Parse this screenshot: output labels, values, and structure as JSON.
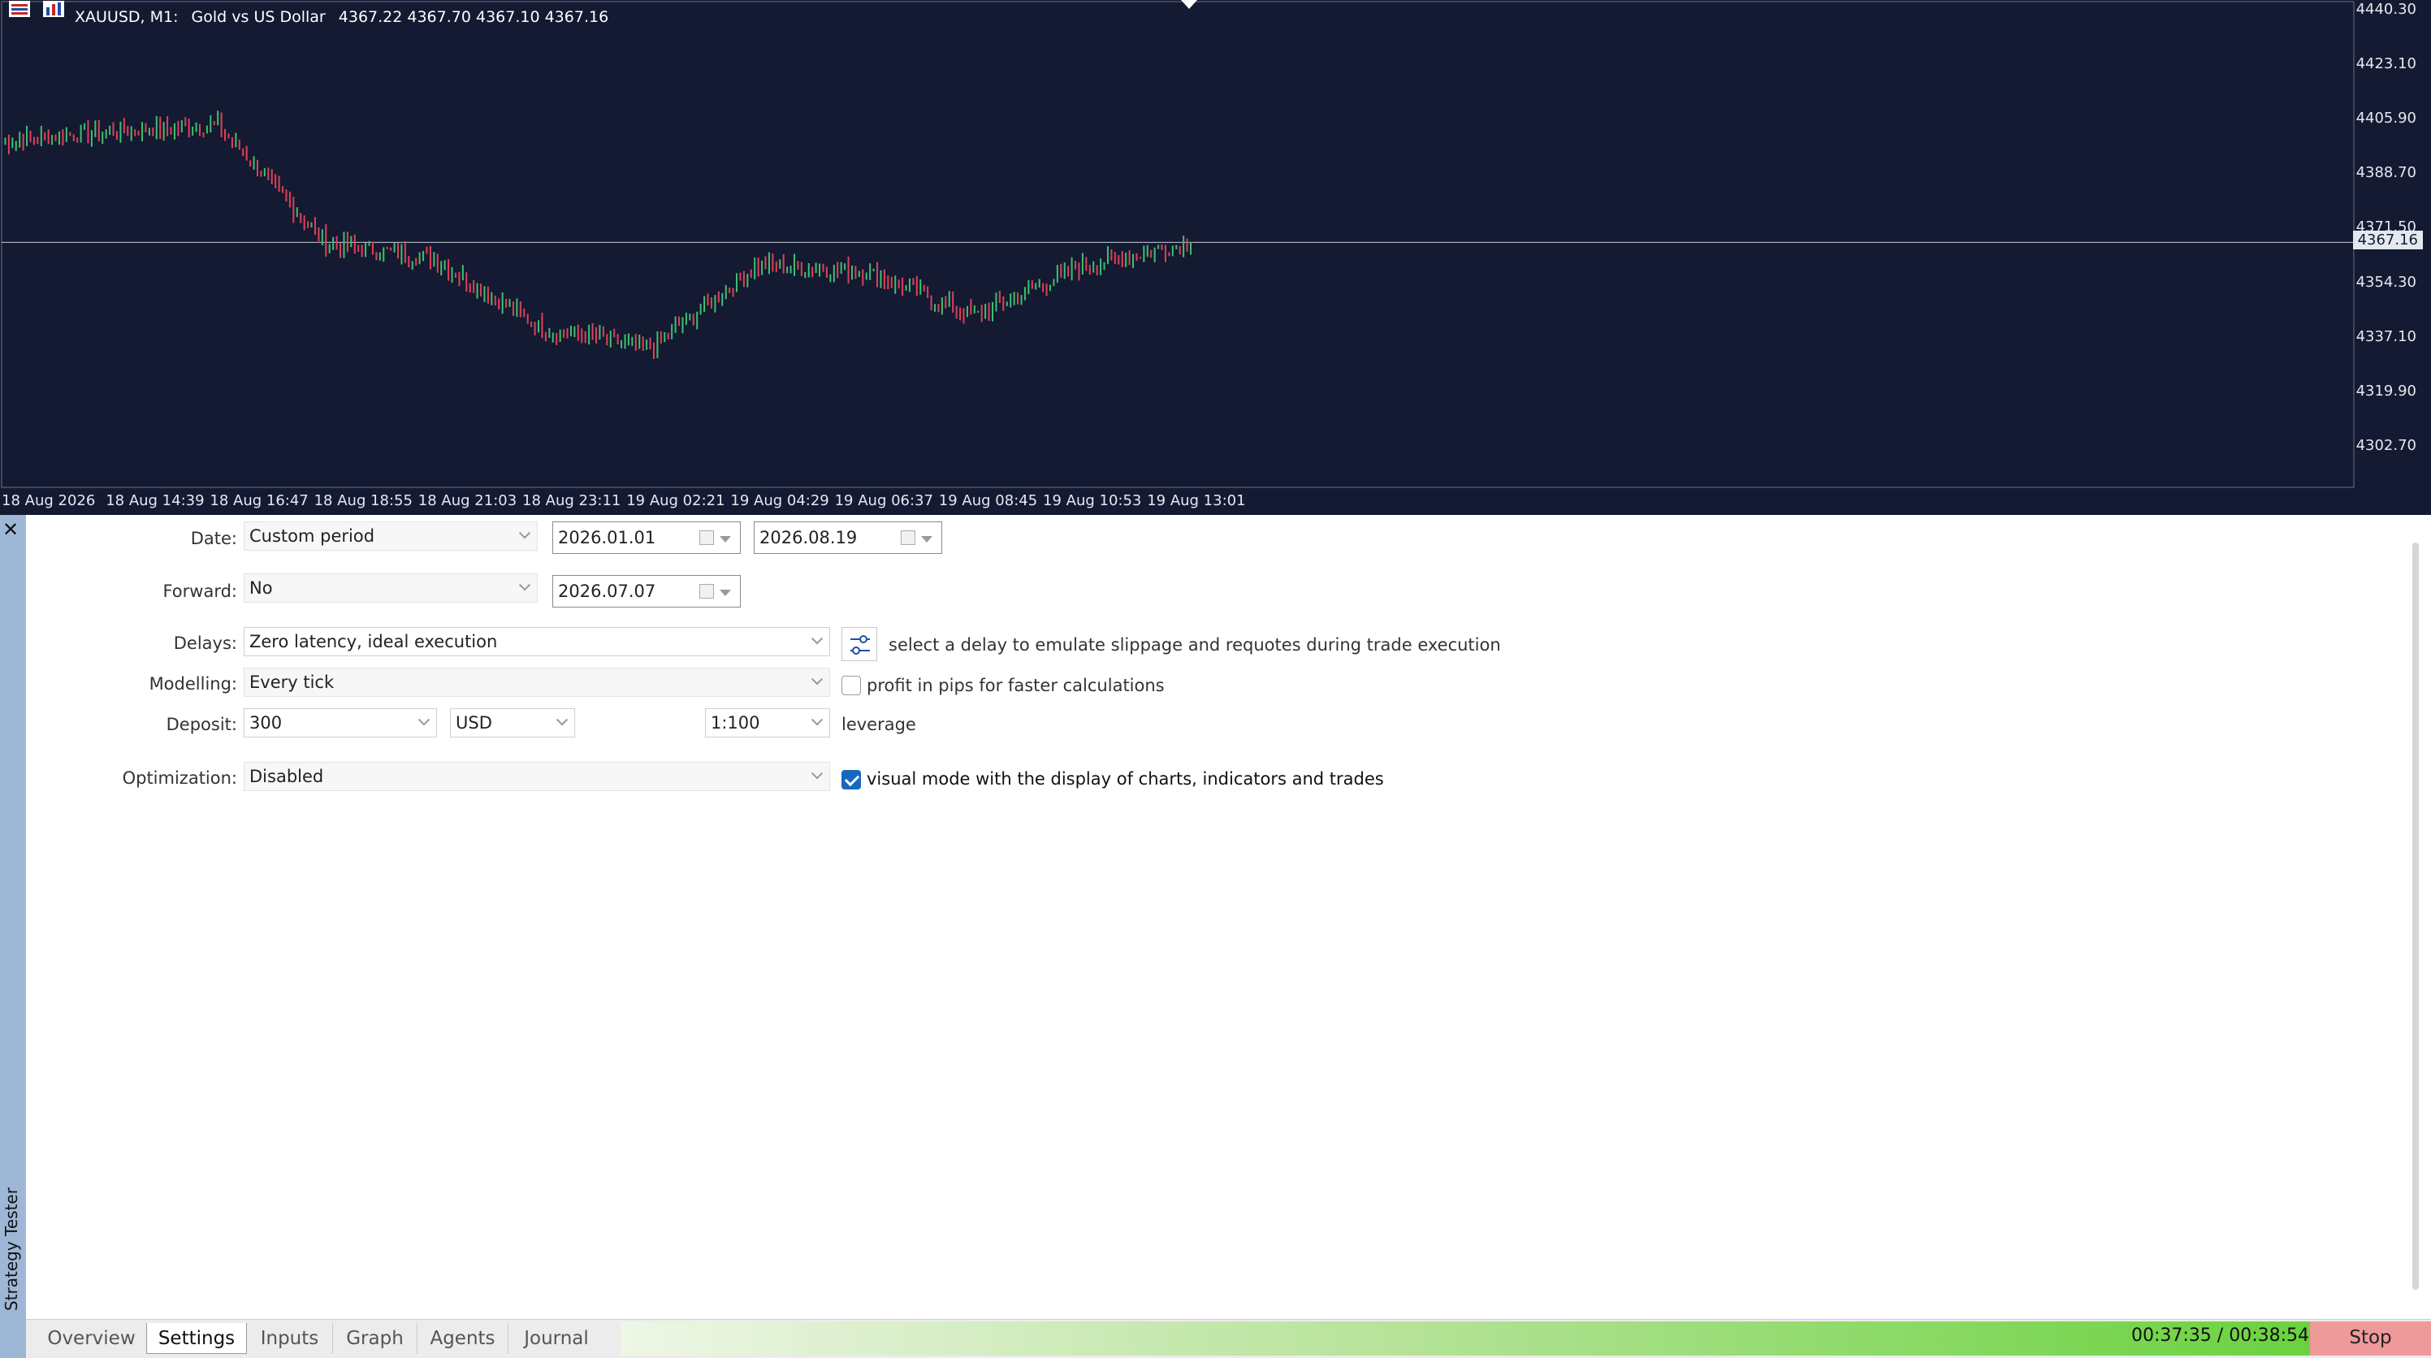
{
  "chart": {
    "title": {
      "symbol": "XAUUSD, M1:",
      "description": "Gold vs US Dollar",
      "ohlc": "4367.22 4367.70 4367.10 4367.16"
    },
    "price_axis": [
      "4440.30",
      "4423.10",
      "4405.90",
      "4388.70",
      "4371.50",
      "4354.30",
      "4337.10",
      "4319.90",
      "4302.70"
    ],
    "current_price": "4367.16",
    "time_axis": [
      "18 Aug 2026",
      "18 Aug 14:39",
      "18 Aug 16:47",
      "18 Aug 18:55",
      "18 Aug 21:03",
      "18 Aug 23:11",
      "19 Aug 02:21",
      "19 Aug 04:29",
      "19 Aug 06:37",
      "19 Aug 08:45",
      "19 Aug 10:53",
      "19 Aug 13:01"
    ],
    "colors": {
      "background": "#131a31",
      "bull": "#3fbf6f",
      "bear": "#e0405a",
      "line": "#c8ccd8"
    }
  },
  "chart_data": {
    "type": "line",
    "x": [
      "18 Aug 2026",
      "18 Aug 14:39",
      "18 Aug 16:47",
      "18 Aug 18:55",
      "18 Aug 21:03",
      "18 Aug 23:11",
      "19 Aug 02:21",
      "19 Aug 04:29",
      "19 Aug 06:37",
      "19 Aug 08:45",
      "19 Aug 10:53",
      "19 Aug 13:01"
    ],
    "values": [
      4399,
      4402,
      4404,
      4367,
      4362,
      4340,
      4334,
      4360,
      4358,
      4344,
      4360,
      4367
    ],
    "ylim": [
      4290,
      4443
    ]
  },
  "panel": {
    "title": "Strategy Tester",
    "close": "✕"
  },
  "settings": {
    "date": {
      "label": "Date:",
      "value": "Custom period",
      "from": "2026.01.01",
      "to": "2026.08.19"
    },
    "forward": {
      "label": "Forward:",
      "value": "No",
      "date": "2026.07.07"
    },
    "delays": {
      "label": "Delays:",
      "value": "Zero latency, ideal execution",
      "hint": "select a delay to emulate slippage and requotes during trade execution"
    },
    "modelling": {
      "label": "Modelling:",
      "value": "Every tick",
      "option": "profit in pips for faster calculations"
    },
    "deposit": {
      "label": "Deposit:",
      "amount": "300",
      "currency": "USD",
      "leverage": "1:100",
      "leverage_label": "leverage"
    },
    "optimization": {
      "label": "Optimization:",
      "value": "Disabled",
      "visual_mode": "visual mode with the display of charts, indicators and trades"
    }
  },
  "tabs": [
    "Overview",
    "Settings",
    "Inputs",
    "Graph",
    "Agents",
    "Journal"
  ],
  "active_tab": "Settings",
  "progress": {
    "timer": "00:37:35 / 00:38:54",
    "fraction": 0.966
  },
  "stop_button": "Stop"
}
